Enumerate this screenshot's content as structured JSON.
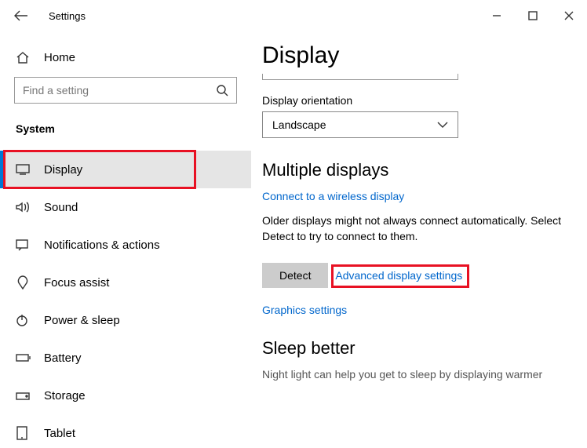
{
  "titlebar": {
    "title": "Settings"
  },
  "sidebar": {
    "home": "Home",
    "search_placeholder": "Find a setting",
    "section": "System",
    "items": [
      {
        "label": "Display"
      },
      {
        "label": "Sound"
      },
      {
        "label": "Notifications & actions"
      },
      {
        "label": "Focus assist"
      },
      {
        "label": "Power & sleep"
      },
      {
        "label": "Battery"
      },
      {
        "label": "Storage"
      },
      {
        "label": "Tablet"
      }
    ]
  },
  "content": {
    "title": "Display",
    "orientation_label": "Display orientation",
    "orientation_value": "Landscape",
    "multiple_heading": "Multiple displays",
    "wireless_link": "Connect to a wireless display",
    "detect_desc": "Older displays might not always connect automatically. Select Detect to try to connect to them.",
    "detect_button": "Detect",
    "advanced_link": "Advanced display settings",
    "graphics_link": "Graphics settings",
    "sleep_heading": "Sleep better",
    "sleep_desc": "Night light can help you get to sleep by displaying warmer"
  }
}
